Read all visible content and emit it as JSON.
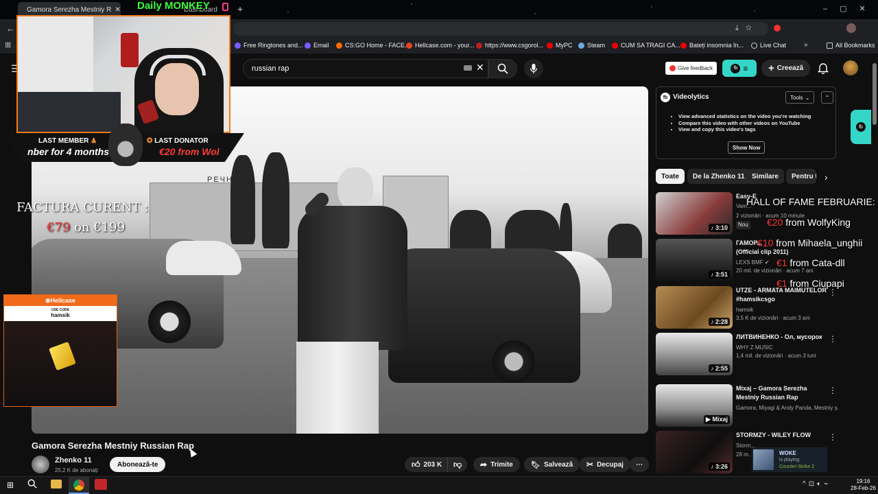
{
  "browser": {
    "tabs": [
      {
        "label": "Gamora Serezha Mestniy R"
      },
      {
        "label": "Daily MONKEY"
      },
      {
        "label": "Dashboard"
      }
    ],
    "bookmarks": [
      {
        "label": "Free Ringtones and...",
        "color": "#7b5cff"
      },
      {
        "label": "Email",
        "color": "#7b5cff"
      },
      {
        "label": "CS:GO Home - FACE...",
        "color": "#ff6a00"
      },
      {
        "label": "Hellcase.com - your...",
        "color": "#e5451d"
      },
      {
        "label": "https://www.csgorol...",
        "color": "#b22"
      },
      {
        "label": "MyPC",
        "color": "#e00"
      },
      {
        "label": "Steam",
        "color": "#6fa8dc"
      },
      {
        "label": "CUM SA TRAGI CA...",
        "color": "#e00"
      },
      {
        "label": "Bateți insomnia în...",
        "color": "#e00"
      },
      {
        "label": "Live Chat",
        "color": "#ccc"
      },
      {
        "label": "All Bookmarks",
        "color": "#ccc"
      }
    ]
  },
  "youtube": {
    "search": {
      "value": "russian rap"
    },
    "feedback_label": "Give feedback",
    "create_label": "Creează",
    "video": {
      "title": "Gamora Serezha Mestniy Russian Rap",
      "channel": "Zhenko 11",
      "subscribers": "25,2 K de abonați",
      "subscribe_label": "Abonează-te",
      "likes": "203 K",
      "share_label": "Trimite",
      "save_label": "Salvează",
      "clip_label": "Decupaj",
      "sign_text": "РЕЧН"
    },
    "videolytics": {
      "title": "Videolytics",
      "tools_label": "Tools",
      "bullets": [
        "View advanced statistics on the video you're watching",
        "Compare this video with other videos on YouTube",
        "View and copy this video's tags"
      ],
      "button": "Show Now"
    },
    "chips": [
      "Toate",
      "De la Zhenko 11",
      "Similare",
      "Pentru t"
    ],
    "recommended": [
      {
        "title": "Easy-E",
        "channel": "Vam...",
        "meta": "2 vizionări · acum 10 minute",
        "badge": "Nou",
        "duration": "3:10"
      },
      {
        "title": "ГАМОР...",
        "title2": "(Official clip 2011)",
        "channel": "LEXS BMF",
        "meta": "20 mil. de vizionări · acum 7 ani",
        "duration": "3:51"
      },
      {
        "title": "UTZE - ARMATA MAIMUTELOR #hamsikcsgo",
        "channel": "hamsik",
        "meta": "3,5 K de vizionări · acum 3 ani",
        "duration": "2:28"
      },
      {
        "title": "ЛИТВИНЕНКО - Ол, мусорок",
        "channel": "WHY Z MUSIC",
        "meta": "1,4 mil. de vizionări · acum 3 luni",
        "duration": "2:55"
      },
      {
        "title": "Mixaj – Gamora Serezha Mestniy  Russian Rap",
        "channel": "Gamora, Miyagi & Andy Panda, Mestniy ș...",
        "meta": "",
        "duration": "Mixaj"
      },
      {
        "title": "STORMZY - WILEY FLOW",
        "channel": "Storm...",
        "meta": "28 m...",
        "duration": "3:26"
      }
    ]
  },
  "stream": {
    "brand": "Daily MONKEY",
    "last_member_label": "LAST MEMBER",
    "last_member_value": "nber for 4 months",
    "last_donator_label": "LAST DONATOR",
    "last_donator_value": "€20 from Wol",
    "factura_title": "FACTURA CURENT :",
    "factura_current": "€79",
    "factura_mid": "on",
    "factura_target": "€199",
    "hellcase_brand": "Hellcase",
    "hellcase_code_label": "USE CODE",
    "hellcase_code": "hamsik",
    "hof_title": "HALL OF FAME FEBRUARIE:",
    "hof": [
      {
        "amount": "€20",
        "text": "from WolfyKing"
      },
      {
        "amount": "€10",
        "text": "from Mihaela_unghii"
      },
      {
        "amount": "€1",
        "text": "from Cata-dll"
      },
      {
        "amount": "€1",
        "text": "from Ciupapi"
      }
    ],
    "now_playing_name": "WOKE",
    "now_playing_status": "is playing",
    "now_playing_game": "Counter-Strike 2"
  },
  "taskbar": {
    "time": "19:16",
    "date": "28-Feb-26"
  }
}
